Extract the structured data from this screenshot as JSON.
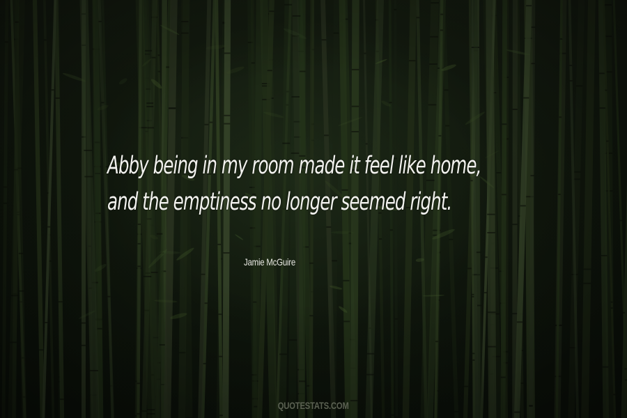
{
  "quote": {
    "lines": [
      "Abby being in my room made it feel like home,",
      "and the emptiness no longer seemed right."
    ]
  },
  "author": "Jamie McGuire",
  "watermark": "QUOTESTATS.COM"
}
